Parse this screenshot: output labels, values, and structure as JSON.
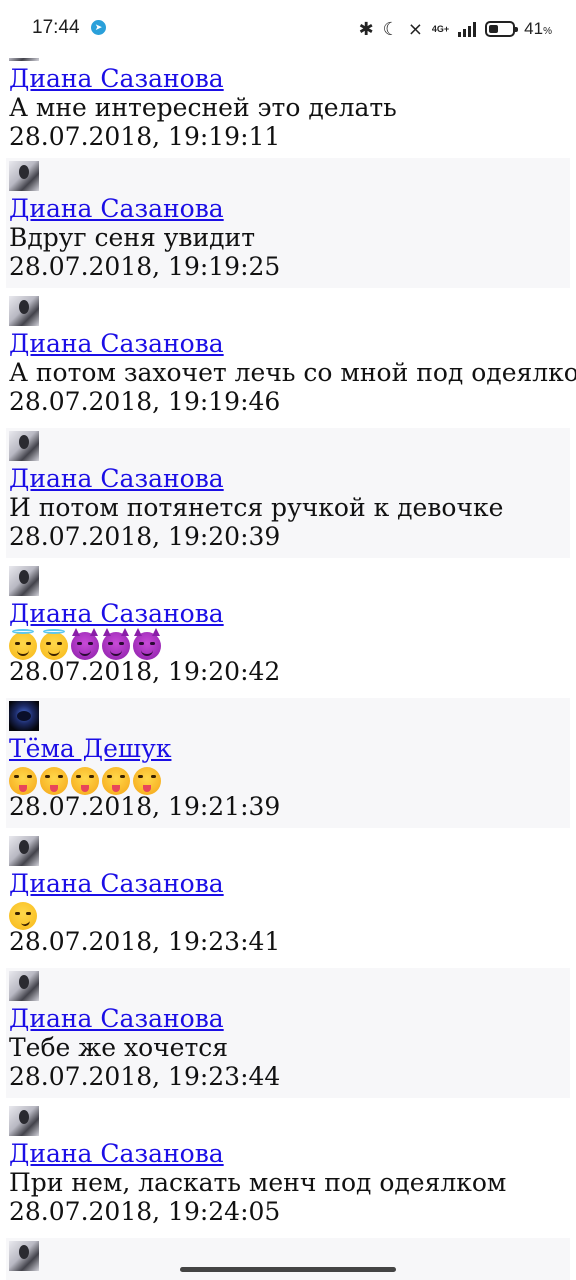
{
  "status_bar": {
    "time": "17:44",
    "network": "4G+",
    "battery_percent": "41",
    "battery_unit": "%",
    "battery_level": 0.41
  },
  "messages": [
    {
      "author": "Диана Сазанова",
      "text": "А мне интереснeй это делать",
      "time": "28.07.2018, 19:19:11"
    },
    {
      "author": "Диана Сазанова",
      "text": "Вдруг сеня увидит",
      "time": "28.07.2018, 19:19:25"
    },
    {
      "author": "Диана Сазанова",
      "text": "А потом захочет лечь со мной под одеялко",
      "time": "28.07.2018, 19:19:46"
    },
    {
      "author": "Диана Сазанова",
      "text": "И потом потянется ручкой к девочке",
      "time": "28.07.2018, 19:20:39"
    },
    {
      "author": "Диана Сазанова",
      "emojis": [
        "smiling-face-with-halo",
        "smiling-face-with-halo",
        "smiling-face-with-horns",
        "smiling-face-with-horns",
        "smiling-face-with-horns"
      ],
      "time": "28.07.2018, 19:20:42"
    },
    {
      "author": "Тёма Дешук",
      "emojis": [
        "squinting-face-with-tongue",
        "squinting-face-with-tongue",
        "squinting-face-with-tongue",
        "squinting-face-with-tongue",
        "squinting-face-with-tongue"
      ],
      "time": "28.07.2018, 19:21:39"
    },
    {
      "author": "Диана Сазанова",
      "emojis": [
        "smirking-face"
      ],
      "time": "28.07.2018, 19:23:41"
    },
    {
      "author": "Диана Сазанова",
      "text": "Тебе же хочется",
      "time": "28.07.2018, 19:23:44"
    },
    {
      "author": "Диана Сазанова",
      "text": "При нем, ласкать менч под одеялком",
      "time": "28.07.2018, 19:24:05"
    }
  ]
}
